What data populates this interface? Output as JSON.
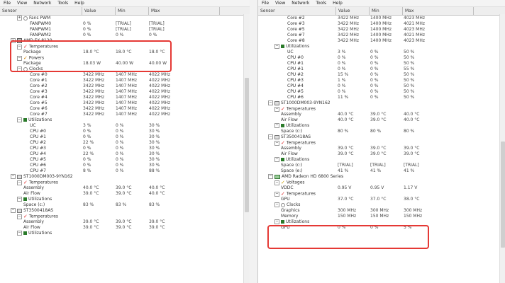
{
  "menu_left": [
    "File",
    "View",
    "Network",
    "Tools",
    "Help"
  ],
  "menu_right": [
    "File",
    "View",
    "Network",
    "Tools",
    "Help"
  ],
  "columns": [
    "Sensor",
    "Value",
    "Min",
    "Max"
  ],
  "left_rows": [
    {
      "d": 1,
      "exp": "+",
      "icon": "fan",
      "name": "Fans PWM",
      "v": "",
      "mi": "",
      "ma": ""
    },
    {
      "d": 3,
      "exp": "",
      "icon": "",
      "name": "FANPWM0",
      "v": "0 %",
      "mi": "[TRIAL]",
      "ma": "[TRIAL]"
    },
    {
      "d": 3,
      "exp": "",
      "icon": "",
      "name": "FANPWM1",
      "v": "0 %",
      "mi": "[TRIAL]",
      "ma": "[TRIAL]"
    },
    {
      "d": 3,
      "exp": "",
      "icon": "",
      "name": "FANPWM2",
      "v": "0 %",
      "mi": "0 %",
      "ma": "0 %"
    },
    {
      "d": 0,
      "exp": "-",
      "icon": "cpu",
      "name": "AMD FX-8120",
      "v": "",
      "mi": "",
      "ma": ""
    },
    {
      "d": 1,
      "exp": "-",
      "icon": "temp",
      "name": "Temperatures",
      "v": "",
      "mi": "",
      "ma": ""
    },
    {
      "d": 2,
      "exp": "",
      "icon": "",
      "name": "Package",
      "v": "18.0 °C",
      "mi": "18.0 °C",
      "ma": "18.0 °C"
    },
    {
      "d": 1,
      "exp": "-",
      "icon": "power",
      "name": "Powers",
      "v": "",
      "mi": "",
      "ma": ""
    },
    {
      "d": 2,
      "exp": "",
      "icon": "",
      "name": "Package",
      "v": "18.03 W",
      "mi": "40.00 W",
      "ma": "40.00 W"
    },
    {
      "d": 1,
      "exp": "-",
      "icon": "clock",
      "name": "Clocks",
      "v": "",
      "mi": "",
      "ma": ""
    },
    {
      "d": 3,
      "exp": "",
      "icon": "",
      "name": "Core #0",
      "v": "3422 MHz",
      "mi": "1407 MHz",
      "ma": "4022 MHz"
    },
    {
      "d": 3,
      "exp": "",
      "icon": "",
      "name": "Core #1",
      "v": "3422 MHz",
      "mi": "1407 MHz",
      "ma": "4022 MHz"
    },
    {
      "d": 3,
      "exp": "",
      "icon": "",
      "name": "Core #2",
      "v": "3422 MHz",
      "mi": "1407 MHz",
      "ma": "4022 MHz"
    },
    {
      "d": 3,
      "exp": "",
      "icon": "",
      "name": "Core #3",
      "v": "3422 MHz",
      "mi": "1407 MHz",
      "ma": "4022 MHz"
    },
    {
      "d": 3,
      "exp": "",
      "icon": "",
      "name": "Core #4",
      "v": "3422 MHz",
      "mi": "1407 MHz",
      "ma": "4022 MHz"
    },
    {
      "d": 3,
      "exp": "",
      "icon": "",
      "name": "Core #5",
      "v": "3422 MHz",
      "mi": "1407 MHz",
      "ma": "4022 MHz"
    },
    {
      "d": 3,
      "exp": "",
      "icon": "",
      "name": "Core #6",
      "v": "3422 MHz",
      "mi": "1407 MHz",
      "ma": "4022 MHz"
    },
    {
      "d": 3,
      "exp": "",
      "icon": "",
      "name": "Core #7",
      "v": "3422 MHz",
      "mi": "1407 MHz",
      "ma": "4022 MHz"
    },
    {
      "d": 1,
      "exp": "-",
      "icon": "util",
      "name": "Utilizations",
      "v": "",
      "mi": "",
      "ma": ""
    },
    {
      "d": 3,
      "exp": "",
      "icon": "",
      "name": "UC",
      "v": "3 %",
      "mi": "0 %",
      "ma": "30 %"
    },
    {
      "d": 3,
      "exp": "",
      "icon": "",
      "name": "CPU #0",
      "v": "0 %",
      "mi": "0 %",
      "ma": "30 %"
    },
    {
      "d": 3,
      "exp": "",
      "icon": "",
      "name": "CPU #1",
      "v": "0 %",
      "mi": "0 %",
      "ma": "30 %"
    },
    {
      "d": 3,
      "exp": "",
      "icon": "",
      "name": "CPU #2",
      "v": "22 %",
      "mi": "0 %",
      "ma": "30 %"
    },
    {
      "d": 3,
      "exp": "",
      "icon": "",
      "name": "CPU #3",
      "v": "0 %",
      "mi": "0 %",
      "ma": "30 %"
    },
    {
      "d": 3,
      "exp": "",
      "icon": "",
      "name": "CPU #4",
      "v": "22 %",
      "mi": "0 %",
      "ma": "30 %"
    },
    {
      "d": 3,
      "exp": "",
      "icon": "",
      "name": "CPU #5",
      "v": "0 %",
      "mi": "0 %",
      "ma": "30 %"
    },
    {
      "d": 3,
      "exp": "",
      "icon": "",
      "name": "CPU #6",
      "v": "0 %",
      "mi": "0 %",
      "ma": "30 %"
    },
    {
      "d": 3,
      "exp": "",
      "icon": "",
      "name": "CPU #7",
      "v": "8 %",
      "mi": "0 %",
      "ma": "88 %"
    },
    {
      "d": 0,
      "exp": "-",
      "icon": "hdd",
      "name": "ST1000DM003-9YN162",
      "v": "",
      "mi": "",
      "ma": ""
    },
    {
      "d": 1,
      "exp": "-",
      "icon": "temp",
      "name": "Temperatures",
      "v": "",
      "mi": "",
      "ma": ""
    },
    {
      "d": 2,
      "exp": "",
      "icon": "",
      "name": "Assembly",
      "v": "40.0 °C",
      "mi": "39.0 °C",
      "ma": "40.0 °C"
    },
    {
      "d": 2,
      "exp": "",
      "icon": "",
      "name": "Air Flow",
      "v": "39.0 °C",
      "mi": "39.0 °C",
      "ma": "40.0 °C"
    },
    {
      "d": 1,
      "exp": "-",
      "icon": "util",
      "name": "Utilizations",
      "v": "",
      "mi": "",
      "ma": ""
    },
    {
      "d": 2,
      "exp": "",
      "icon": "",
      "name": "Space (c:)",
      "v": "83 %",
      "mi": "83 %",
      "ma": "83 %"
    },
    {
      "d": 0,
      "exp": "-",
      "icon": "hdd",
      "name": "ST3500418AS",
      "v": "",
      "mi": "",
      "ma": ""
    },
    {
      "d": 1,
      "exp": "-",
      "icon": "temp",
      "name": "Temperatures",
      "v": "",
      "mi": "",
      "ma": ""
    },
    {
      "d": 2,
      "exp": "",
      "icon": "",
      "name": "Assembly",
      "v": "39.0 °C",
      "mi": "39.0 °C",
      "ma": "39.0 °C"
    },
    {
      "d": 2,
      "exp": "",
      "icon": "",
      "name": "Air Flow",
      "v": "39.0 °C",
      "mi": "39.0 °C",
      "ma": "39.0 °C"
    },
    {
      "d": 1,
      "exp": "-",
      "icon": "util",
      "name": "Utilizations",
      "v": "",
      "mi": "",
      "ma": ""
    }
  ],
  "right_rows": [
    {
      "d": 3,
      "exp": "",
      "icon": "",
      "name": "Core #2",
      "v": "3422 MHz",
      "mi": "1400 MHz",
      "ma": "4023 MHz"
    },
    {
      "d": 3,
      "exp": "",
      "icon": "",
      "name": "Core #3",
      "v": "3422 MHz",
      "mi": "1400 MHz",
      "ma": "4021 MHz"
    },
    {
      "d": 3,
      "exp": "",
      "icon": "",
      "name": "Core #5",
      "v": "3422 MHz",
      "mi": "1400 MHz",
      "ma": "4023 MHz"
    },
    {
      "d": 3,
      "exp": "",
      "icon": "",
      "name": "Core #7",
      "v": "3422 MHz",
      "mi": "1400 MHz",
      "ma": "4021 MHz"
    },
    {
      "d": 3,
      "exp": "",
      "icon": "",
      "name": "Core #8",
      "v": "3422 MHz",
      "mi": "1400 MHz",
      "ma": "4023 MHz"
    },
    {
      "d": 1,
      "exp": "-",
      "icon": "util",
      "name": "Utilizations",
      "v": "",
      "mi": "",
      "ma": ""
    },
    {
      "d": 3,
      "exp": "",
      "icon": "",
      "name": "UC",
      "v": "3 %",
      "mi": "0 %",
      "ma": "50 %"
    },
    {
      "d": 3,
      "exp": "",
      "icon": "",
      "name": "CPU #0",
      "v": "0 %",
      "mi": "0 %",
      "ma": "50 %"
    },
    {
      "d": 3,
      "exp": "",
      "icon": "",
      "name": "CPU #1",
      "v": "0 %",
      "mi": "0 %",
      "ma": "50 %"
    },
    {
      "d": 3,
      "exp": "",
      "icon": "",
      "name": "CPU #1",
      "v": "0 %",
      "mi": "0 %",
      "ma": "55 %"
    },
    {
      "d": 3,
      "exp": "",
      "icon": "",
      "name": "CPU #2",
      "v": "15 %",
      "mi": "0 %",
      "ma": "50 %"
    },
    {
      "d": 3,
      "exp": "",
      "icon": "",
      "name": "CPU #3",
      "v": "1 %",
      "mi": "0 %",
      "ma": "50 %"
    },
    {
      "d": 3,
      "exp": "",
      "icon": "",
      "name": "CPU #4",
      "v": "0 %",
      "mi": "0 %",
      "ma": "50 %"
    },
    {
      "d": 3,
      "exp": "",
      "icon": "",
      "name": "CPU #5",
      "v": "0 %",
      "mi": "0 %",
      "ma": "50 %"
    },
    {
      "d": 3,
      "exp": "",
      "icon": "",
      "name": "CPU #6",
      "v": "11 %",
      "mi": "0 %",
      "ma": "50 %"
    },
    {
      "d": 0,
      "exp": "-",
      "icon": "hdd",
      "name": "ST1000DM003-9YN162",
      "v": "",
      "mi": "",
      "ma": ""
    },
    {
      "d": 1,
      "exp": "-",
      "icon": "temp",
      "name": "Temperatures",
      "v": "",
      "mi": "",
      "ma": ""
    },
    {
      "d": 2,
      "exp": "",
      "icon": "",
      "name": "Assembly",
      "v": "40.0 °C",
      "mi": "39.0 °C",
      "ma": "40.0 °C"
    },
    {
      "d": 2,
      "exp": "",
      "icon": "",
      "name": "Air Flow",
      "v": "40.0 °C",
      "mi": "39.0 °C",
      "ma": "40.0 °C"
    },
    {
      "d": 1,
      "exp": "-",
      "icon": "util",
      "name": "Utilizations",
      "v": "",
      "mi": "",
      "ma": ""
    },
    {
      "d": 2,
      "exp": "",
      "icon": "",
      "name": "Space (c:)",
      "v": "80 %",
      "mi": "80 %",
      "ma": "80 %"
    },
    {
      "d": 0,
      "exp": "-",
      "icon": "hdd",
      "name": "ST3500418AS",
      "v": "",
      "mi": "",
      "ma": ""
    },
    {
      "d": 1,
      "exp": "-",
      "icon": "temp",
      "name": "Temperatures",
      "v": "",
      "mi": "",
      "ma": ""
    },
    {
      "d": 2,
      "exp": "",
      "icon": "",
      "name": "Assembly",
      "v": "39.0 °C",
      "mi": "39.0 °C",
      "ma": "39.0 °C"
    },
    {
      "d": 2,
      "exp": "",
      "icon": "",
      "name": "Air Flow",
      "v": "39.0 °C",
      "mi": "39.0 °C",
      "ma": "39.0 °C"
    },
    {
      "d": 1,
      "exp": "-",
      "icon": "util",
      "name": "Utilizations",
      "v": "",
      "mi": "",
      "ma": ""
    },
    {
      "d": 2,
      "exp": "",
      "icon": "",
      "name": "Space (c:)",
      "v": "[TRIAL]",
      "mi": "[TRIAL]",
      "ma": "[TRIAL]"
    },
    {
      "d": 2,
      "exp": "",
      "icon": "",
      "name": "Space (e:)",
      "v": "41 %",
      "mi": "41 %",
      "ma": "41 %"
    },
    {
      "d": 0,
      "exp": "-",
      "icon": "gpu",
      "name": "AMD Radeon HD 6800 Series",
      "v": "",
      "mi": "",
      "ma": ""
    },
    {
      "d": 1,
      "exp": "-",
      "icon": "volt",
      "name": "Voltages",
      "v": "",
      "mi": "",
      "ma": ""
    },
    {
      "d": 2,
      "exp": "",
      "icon": "",
      "name": "VDDC",
      "v": "0.95 V",
      "mi": "0.95 V",
      "ma": "1.17 V"
    },
    {
      "d": 1,
      "exp": "-",
      "icon": "temp",
      "name": "Temperatures",
      "v": "",
      "mi": "",
      "ma": ""
    },
    {
      "d": 2,
      "exp": "",
      "icon": "",
      "name": "GPU",
      "v": "37.0 °C",
      "mi": "37.0 °C",
      "ma": "38.0 °C"
    },
    {
      "d": 1,
      "exp": "-",
      "icon": "clock",
      "name": "Clocks",
      "v": "",
      "mi": "",
      "ma": ""
    },
    {
      "d": 2,
      "exp": "",
      "icon": "",
      "name": "Graphics",
      "v": "300 MHz",
      "mi": "300 MHz",
      "ma": "300 MHz"
    },
    {
      "d": 2,
      "exp": "",
      "icon": "",
      "name": "Memory",
      "v": "150 MHz",
      "mi": "150 MHz",
      "ma": "150 MHz"
    },
    {
      "d": 1,
      "exp": "-",
      "icon": "util",
      "name": "Utilizations",
      "v": "",
      "mi": "",
      "ma": ""
    },
    {
      "d": 2,
      "exp": "",
      "icon": "",
      "name": "GPU",
      "v": "0 %",
      "mi": "0 %",
      "ma": "5 %"
    }
  ]
}
